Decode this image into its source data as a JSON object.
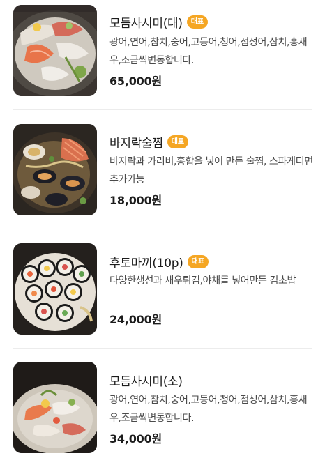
{
  "menu": {
    "items": [
      {
        "name": "모듬사시미(대)",
        "badge": "대표",
        "description": "광어,연어,참치,숭어,고등어,청어,점성어,삼치,홍새우,조금씩변동합니다.",
        "price": "65,000원",
        "image": "sashimi-platter-photo"
      },
      {
        "name": "바지락술찜",
        "badge": "대표",
        "description": "바지락과 가리비,홍합을 넣어 만든 술찜, 스파게티면 추가가능",
        "price": "18,000원",
        "image": "clam-stew-photo"
      },
      {
        "name": "후토마끼(10p)",
        "badge": "대표",
        "description": "다양한생선과 새우튀김,야채를 넣어만든 김초밥",
        "price": "24,000원",
        "image": "futomaki-photo"
      },
      {
        "name": "모듬사시미(소)",
        "badge": "",
        "description": "광어,연어,참치,숭어,고등어,청어,점성어,삼치,홍새우,조금씩변동합니다.",
        "price": "34,000원",
        "image": "sashimi-small-photo"
      }
    ]
  },
  "colors": {
    "badge": "#f5a623",
    "text": "#1c1c1c",
    "description": "#4a4a4a",
    "divider": "#ececec"
  }
}
